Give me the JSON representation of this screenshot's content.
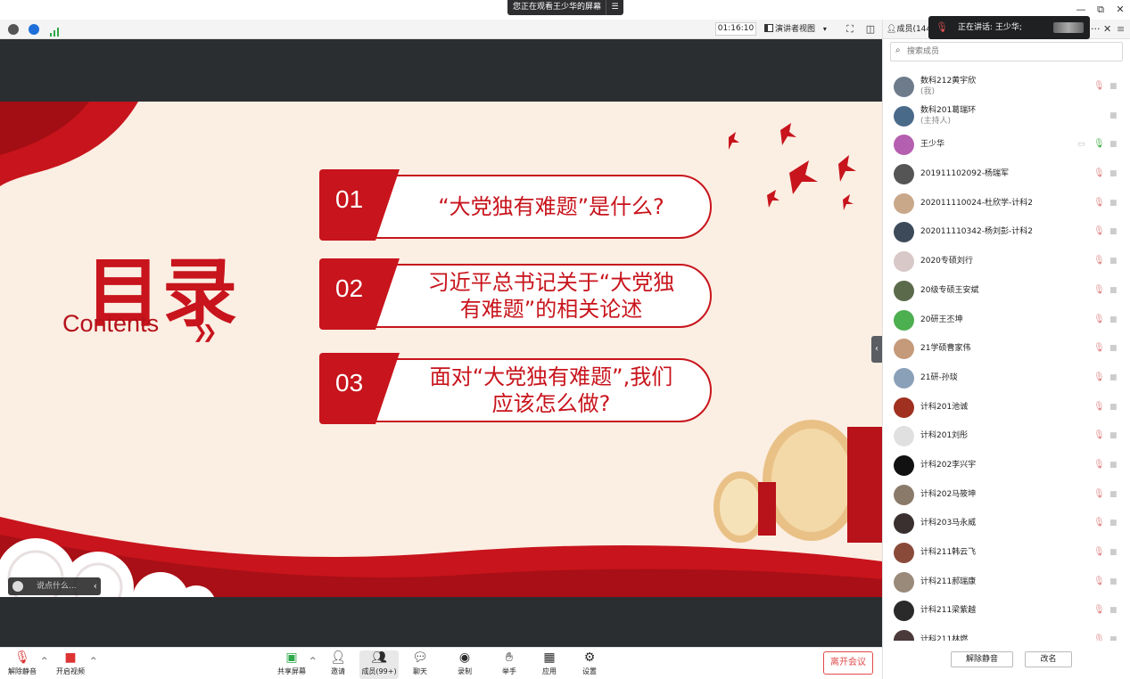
{
  "window": {
    "share_banner": "您正在观看王少华的屏幕",
    "share_menu_icon": "list-icon",
    "minimize": "—",
    "restore": "⧉",
    "close": "✕"
  },
  "infobar": {
    "timer": "01:16:10",
    "view_label": "演讲者视图",
    "view_caret": "▾"
  },
  "slide": {
    "title_cn": "目录",
    "title_en": "Contents",
    "chevron": "»",
    "items": [
      {
        "num": "01",
        "text": "“大党独有难题”是什么?"
      },
      {
        "num": "02",
        "text": "习近平总书记关于“大党独有难题”的相关论述"
      },
      {
        "num": "03",
        "text": "面对“大党独有难题”,我们应该怎么做?"
      }
    ]
  },
  "chat_pill": {
    "placeholder": "说点什么...",
    "arrow": "‹"
  },
  "toolbar": {
    "unmute": "解除静音",
    "start_video": "开启视频",
    "share_screen": "共享屏幕",
    "invite": "邀请",
    "members": "成员(99+)",
    "chat": "聊天",
    "record": "录制",
    "raise_hand": "举手",
    "apps": "应用",
    "settings": "设置",
    "leave": "离开会议"
  },
  "panel": {
    "header_label": "成员(144",
    "speaking_label": "正在讲话: 王少华;",
    "more": "···",
    "close": "✕",
    "menu": "≡",
    "search_placeholder": "搜索成员",
    "members": [
      {
        "name": "数科212黄宇欣",
        "sub": "(我)",
        "avatar": "#6d7b8a",
        "mute": true,
        "cam": true
      },
      {
        "name": "数科201葛瑞环",
        "sub": "(主持人)",
        "avatar": "#4a6a8a",
        "mute": false,
        "cam": true
      },
      {
        "name": "王少华",
        "sub": "",
        "avatar": "#b55fb0",
        "mute": false,
        "cam": true,
        "speaking": true,
        "sharing": true
      },
      {
        "name": "201911102092-杨瑞军",
        "sub": "",
        "avatar": "#555555",
        "mute": true,
        "cam": true
      },
      {
        "name": "202011110024-杜欣学-计科2",
        "sub": "",
        "avatar": "#c9a88a",
        "mute": true,
        "cam": true
      },
      {
        "name": "202011110342-杨刘彭-计科2",
        "sub": "",
        "avatar": "#3d4a5a",
        "mute": true,
        "cam": true
      },
      {
        "name": "2020专硕刘行",
        "sub": "",
        "avatar": "#d8c8c8",
        "mute": true,
        "cam": true
      },
      {
        "name": "20级专硕王安斌",
        "sub": "",
        "avatar": "#5a6a4a",
        "mute": true,
        "cam": true
      },
      {
        "name": "20研王丕坤",
        "sub": "",
        "avatar": "#4caf50",
        "mute": true,
        "cam": true
      },
      {
        "name": "21学硕曹家伟",
        "sub": "",
        "avatar": "#c49a7a",
        "mute": true,
        "cam": true
      },
      {
        "name": "21研-孙琰",
        "sub": "",
        "avatar": "#8aa0b8",
        "mute": true,
        "cam": true
      },
      {
        "name": "计科201池诚",
        "sub": "",
        "avatar": "#a03020",
        "mute": true,
        "cam": true
      },
      {
        "name": "计科201刘彤",
        "sub": "",
        "avatar": "#e0e0e0",
        "mute": true,
        "cam": true
      },
      {
        "name": "计科202李兴宇",
        "sub": "",
        "avatar": "#111111",
        "mute": true,
        "cam": true
      },
      {
        "name": "计科202马筱坤",
        "sub": "",
        "avatar": "#8a7a6a",
        "mute": true,
        "cam": true
      },
      {
        "name": "计科203马永威",
        "sub": "",
        "avatar": "#3a3030",
        "mute": true,
        "cam": true
      },
      {
        "name": "计科211韩云飞",
        "sub": "",
        "avatar": "#8a4a3a",
        "mute": true,
        "cam": true
      },
      {
        "name": "计科211郝瑞康",
        "sub": "",
        "avatar": "#9a8a7a",
        "mute": true,
        "cam": true
      },
      {
        "name": "计科211梁紫越",
        "sub": "",
        "avatar": "#2a2a2a",
        "mute": true,
        "cam": true
      },
      {
        "name": "计科211林燃",
        "sub": "",
        "avatar": "#4a3a3a",
        "mute": true,
        "cam": true
      }
    ],
    "unmute_btn": "解除静音",
    "rename_btn": "改名"
  },
  "colors": {
    "accent_red": "#c8141c",
    "leave_red": "#e04b4b",
    "speaking_green": "#4caf50"
  }
}
